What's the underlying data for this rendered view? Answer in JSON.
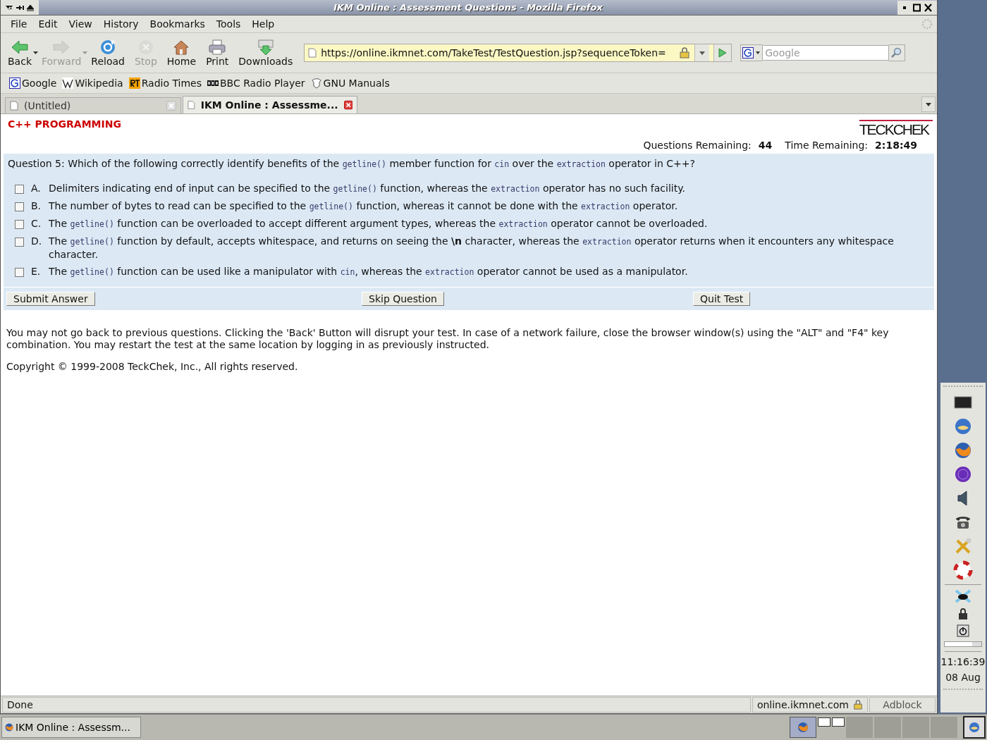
{
  "window": {
    "title": "IKM Online : Assessment Questions - Mozilla Firefox"
  },
  "menu": [
    "File",
    "Edit",
    "View",
    "History",
    "Bookmarks",
    "Tools",
    "Help"
  ],
  "toolbar": [
    {
      "label": "Back",
      "kind": "back",
      "disabled": false,
      "dropdown": true
    },
    {
      "label": "Forward",
      "kind": "forward",
      "disabled": true,
      "dropdown": true
    },
    {
      "label": "Reload",
      "kind": "reload",
      "disabled": false,
      "dropdown": false
    },
    {
      "label": "Stop",
      "kind": "stop",
      "disabled": true,
      "dropdown": false
    },
    {
      "label": "Home",
      "kind": "home",
      "disabled": false,
      "dropdown": false
    },
    {
      "label": "Print",
      "kind": "print",
      "disabled": false,
      "dropdown": false
    },
    {
      "label": "Downloads",
      "kind": "downloads",
      "disabled": false,
      "dropdown": false
    }
  ],
  "address": {
    "value": "https://online.ikmnet.com/TakeTest/TestQuestion.jsp?sequenceToken="
  },
  "search": {
    "placeholder": "Google"
  },
  "bookmarks": [
    {
      "label": "Google",
      "kind": "google"
    },
    {
      "label": "Wikipedia",
      "kind": "wikipedia"
    },
    {
      "label": "Radio Times",
      "kind": "rt"
    },
    {
      "label": "BBC Radio Player",
      "kind": "bbc"
    },
    {
      "label": "GNU Manuals",
      "kind": "gnu"
    }
  ],
  "tabs": [
    {
      "label": "(Untitled)",
      "selected": false
    },
    {
      "label": "IKM Online : Assessme...",
      "selected": true
    }
  ],
  "page": {
    "heading": "C++ PROGRAMMING",
    "logo": "TECKCHEK",
    "stats": [
      {
        "label": "Questions Remaining:",
        "value": "44"
      },
      {
        "label": "Time Remaining:",
        "value": "2:18:49"
      }
    ],
    "question": [
      {
        "kind": "text",
        "text": "Question 5: Which of the following correctly identify benefits of the "
      },
      {
        "kind": "code",
        "text": "getline()"
      },
      {
        "kind": "text",
        "text": " member function for "
      },
      {
        "kind": "code",
        "text": "cin"
      },
      {
        "kind": "text",
        "text": " over the "
      },
      {
        "kind": "code",
        "text": "extraction"
      },
      {
        "kind": "text",
        "text": " operator in C++?"
      }
    ],
    "options": [
      {
        "letter": "A.",
        "checked": false,
        "parts": [
          {
            "kind": "text",
            "text": "Delimiters indicating end of input can be specified to the "
          },
          {
            "kind": "code",
            "text": "getline()"
          },
          {
            "kind": "text",
            "text": " function, whereas the "
          },
          {
            "kind": "code",
            "text": "extraction"
          },
          {
            "kind": "text",
            "text": " operator has no such facility."
          }
        ]
      },
      {
        "letter": "B.",
        "checked": false,
        "parts": [
          {
            "kind": "text",
            "text": "The number of bytes to read can be specified to the "
          },
          {
            "kind": "code",
            "text": "getline()"
          },
          {
            "kind": "text",
            "text": " function, whereas it cannot be done with the "
          },
          {
            "kind": "code",
            "text": "extraction"
          },
          {
            "kind": "text",
            "text": " operator."
          }
        ]
      },
      {
        "letter": "C.",
        "checked": false,
        "parts": [
          {
            "kind": "text",
            "text": "The "
          },
          {
            "kind": "code",
            "text": "getline()"
          },
          {
            "kind": "text",
            "text": " function can be overloaded to accept different argument types, whereas the "
          },
          {
            "kind": "code",
            "text": "extraction"
          },
          {
            "kind": "text",
            "text": " operator cannot be overloaded."
          }
        ]
      },
      {
        "letter": "D.",
        "checked": false,
        "parts": [
          {
            "kind": "text",
            "text": "The "
          },
          {
            "kind": "code",
            "text": "getline()"
          },
          {
            "kind": "text",
            "text": " function by default, accepts whitespace, and returns on seeing the "
          },
          {
            "kind": "bold",
            "text": "\\n"
          },
          {
            "kind": "text",
            "text": " character, whereas the "
          },
          {
            "kind": "code",
            "text": "extraction"
          },
          {
            "kind": "text",
            "text": " operator returns when it encounters any whitespace character."
          }
        ]
      },
      {
        "letter": "E.",
        "checked": false,
        "parts": [
          {
            "kind": "text",
            "text": "The "
          },
          {
            "kind": "code",
            "text": "getline()"
          },
          {
            "kind": "text",
            "text": " function can be used like a manipulator with "
          },
          {
            "kind": "code",
            "text": "cin"
          },
          {
            "kind": "text",
            "text": ", whereas the "
          },
          {
            "kind": "code",
            "text": "extraction"
          },
          {
            "kind": "text",
            "text": " operator cannot be used as a manipulator."
          }
        ]
      }
    ],
    "buttons": [
      "Submit Answer",
      "Skip Question",
      "Quit Test"
    ],
    "notice": "You may not go back to previous questions. Clicking the 'Back' Button will disrupt your test. In case of a network failure, close the browser window(s) using the \"ALT\" and \"F4\" key combination. You may restart the test at the same location by logging in as previously instructed.",
    "copyright": "Copyright © 1999-2008 TeckChek, Inc., All rights reserved."
  },
  "status_bar": {
    "status": "Done",
    "host": "online.ikmnet.com",
    "adblock": "Adblock"
  },
  "side_panel": {
    "time": "11:16:39",
    "date": "08 Aug",
    "level": 0.75
  },
  "taskbar": {
    "task": "IKM Online : Assessm..."
  }
}
